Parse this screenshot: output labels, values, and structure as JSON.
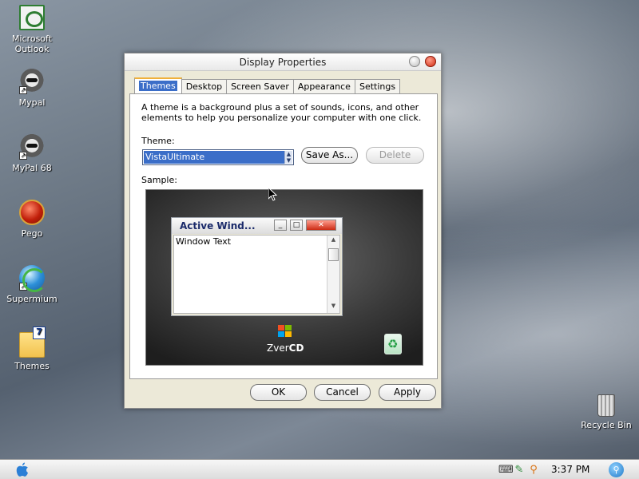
{
  "desktop": {
    "icons": [
      {
        "label": "Microsoft Outlook",
        "icon": "outlook-icon"
      },
      {
        "label": "Mypal",
        "icon": "raccoon-icon"
      },
      {
        "label": "MyPal 68",
        "icon": "raccoon-icon"
      },
      {
        "label": "Pego",
        "icon": "pego-icon"
      },
      {
        "label": "Supermium",
        "icon": "supermium-icon"
      },
      {
        "label": "Themes",
        "icon": "folder-icon"
      },
      {
        "label": "Recycle Bin",
        "icon": "recycle-bin-icon"
      }
    ]
  },
  "window": {
    "title": "Display Properties",
    "tabs": [
      {
        "label": "Themes",
        "active": true
      },
      {
        "label": "Desktop",
        "active": false
      },
      {
        "label": "Screen Saver",
        "active": false
      },
      {
        "label": "Appearance",
        "active": false
      },
      {
        "label": "Settings",
        "active": false
      }
    ],
    "description": "A theme is a background plus a set of sounds, icons, and other elements to help you personalize your computer with one click.",
    "theme_label": "Theme:",
    "theme_value": "VistaUltimate",
    "save_as_label": "Save As...",
    "delete_label": "Delete",
    "sample_label": "Sample:",
    "sample": {
      "window_title": "Active Wind...",
      "window_text": "Window Text",
      "brand_prefix": "Zver",
      "brand_suffix": "CD"
    },
    "ok_label": "OK",
    "cancel_label": "Cancel",
    "apply_label": "Apply"
  },
  "taskbar": {
    "clock": "3:37 PM"
  },
  "colors": {
    "selection": "#3b6ec8",
    "close_button": "#d02a10"
  }
}
